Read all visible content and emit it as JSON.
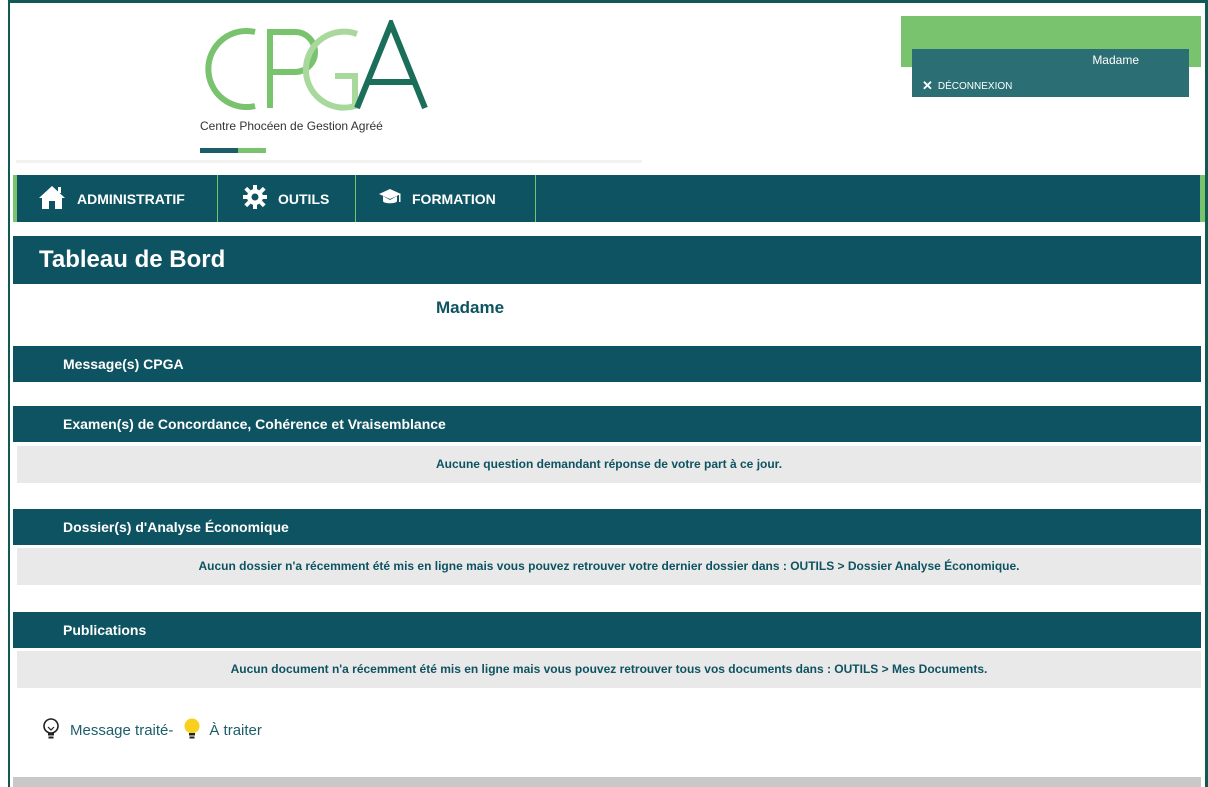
{
  "brand": {
    "logo_text": "CPGA",
    "subtitle": "Centre Phocéen de Gestion Agréé",
    "colors": {
      "teal": "#0e5361",
      "green": "#79c26e",
      "light_green": "#a9d89c"
    }
  },
  "user": {
    "name": "Madame",
    "logout_label": "DÉCONNEXION",
    "logout_icon": "close-icon"
  },
  "nav": {
    "items": [
      {
        "label": "ADMINISTRATIF",
        "icon": "home-icon"
      },
      {
        "label": "OUTILS",
        "icon": "gear-icon"
      },
      {
        "label": "FORMATION",
        "icon": "graduation-cap-icon"
      }
    ]
  },
  "page": {
    "title": "Tableau de Bord",
    "greeting": "Madame"
  },
  "sections": [
    {
      "title": "Message(s) CPGA",
      "body": ""
    },
    {
      "title": "Examen(s) de Concordance, Cohérence et Vraisemblance",
      "body": "Aucune question demandant réponse de votre part à ce jour."
    },
    {
      "title": "Dossier(s) d'Analyse Économique",
      "body": "Aucun dossier n'a récemment été mis en ligne mais vous pouvez retrouver votre dernier dossier dans : OUTILS > Dossier Analyse Économique."
    },
    {
      "title": "Publications",
      "body": "Aucun document n'a récemment été mis en ligne mais vous pouvez retrouver tous vos documents dans : OUTILS > Mes Documents."
    }
  ],
  "legend": {
    "treated_label": "Message traité-",
    "treated_icon": "lightbulb-outline-icon",
    "pending_label": "À traiter",
    "pending_icon": "lightbulb-yellow-icon"
  }
}
